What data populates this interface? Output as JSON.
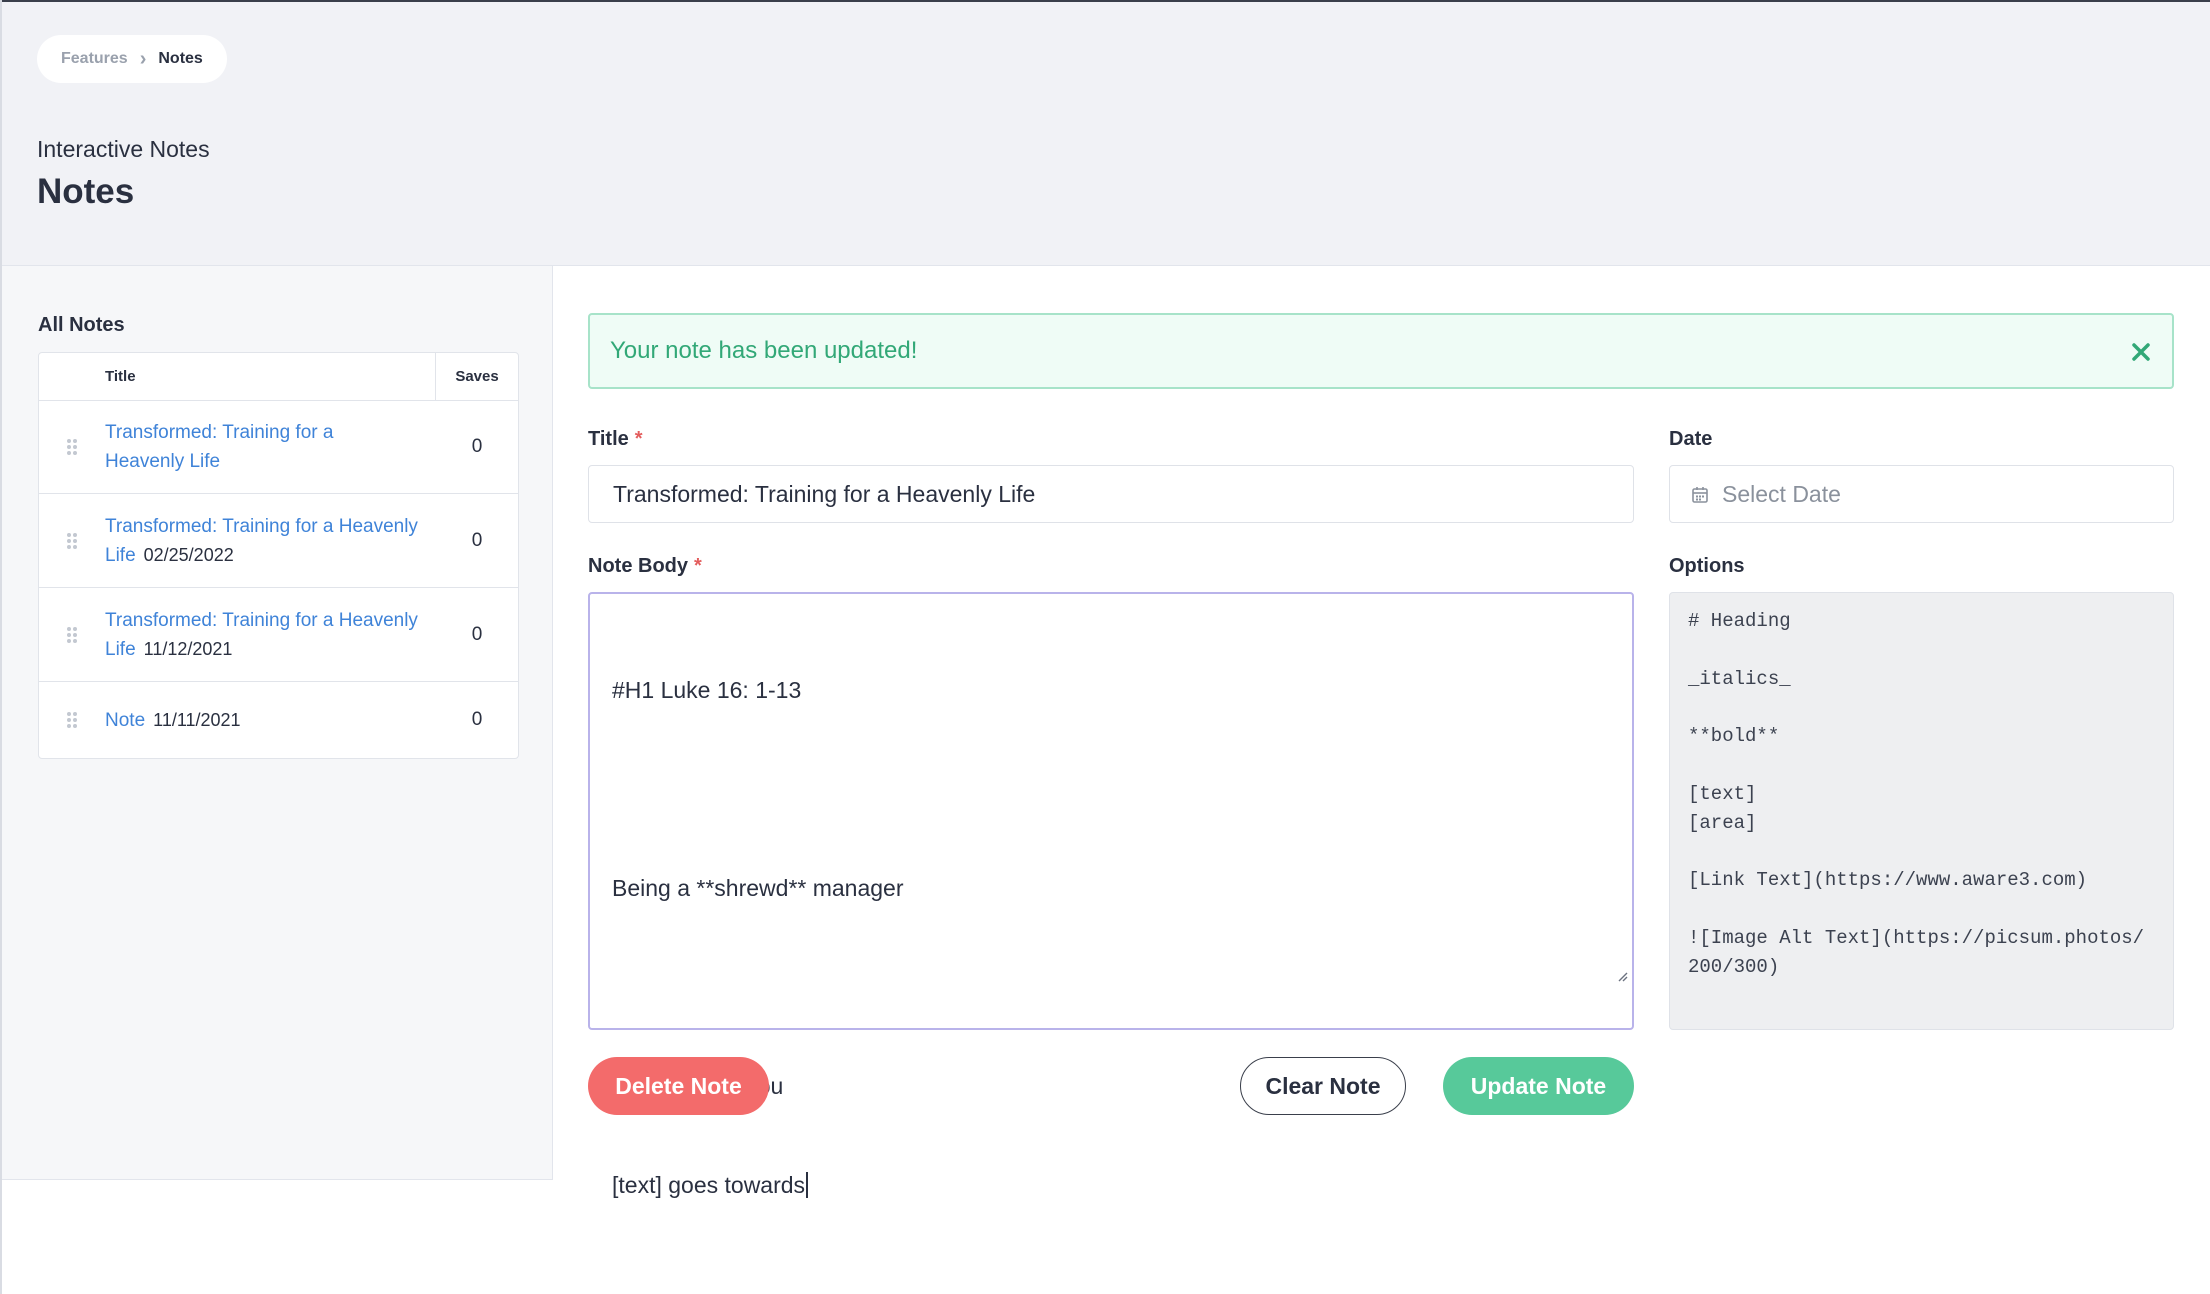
{
  "breadcrumb": {
    "parent": "Features",
    "separator": "›",
    "current": "Notes"
  },
  "header": {
    "subtitle": "Interactive Notes",
    "title": "Notes"
  },
  "sidebar": {
    "heading": "All Notes",
    "columns": {
      "title": "Title",
      "saves": "Saves"
    },
    "rows": [
      {
        "title": "Transformed: Training for a Heavenly Life",
        "date": "",
        "saves": "0"
      },
      {
        "title": "Transformed: Training for a Heavenly Life",
        "date": "02/25/2022",
        "saves": "0"
      },
      {
        "title": "Transformed: Training for a Heavenly Life",
        "date": "11/12/2021",
        "saves": "0"
      },
      {
        "title": "Note",
        "date": "11/11/2021",
        "saves": "0"
      }
    ]
  },
  "alert": {
    "message": "Your note has been updated!",
    "close_icon": "close-x-icon"
  },
  "form": {
    "title_label": "Title",
    "title_value": "Transformed: Training for a Heavenly Life",
    "date_label": "Date",
    "date_placeholder": "Select Date",
    "body_label": "Note Body",
    "body_lines": [
      "#H1 Luke 16: 1-13",
      "",
      "Being a **shrewd** manager",
      "",
      "investing_in_you",
      "[text] goes towards"
    ],
    "options_label": "Options",
    "options_text": "# Heading\n\n_italics_\n\n**bold**\n\n[text]\n[area]\n\n[Link Text](https://www.aware3.com)\n\n![Image Alt Text](https://picsum.photos/200/300)",
    "required_mark": "*"
  },
  "buttons": {
    "delete": "Delete Note",
    "clear": "Clear Note",
    "update": "Update Note"
  },
  "colors": {
    "primary_link": "#3f83d8",
    "success": "#57c99a",
    "danger": "#f36b6b",
    "alert_bg": "#effcf6"
  }
}
